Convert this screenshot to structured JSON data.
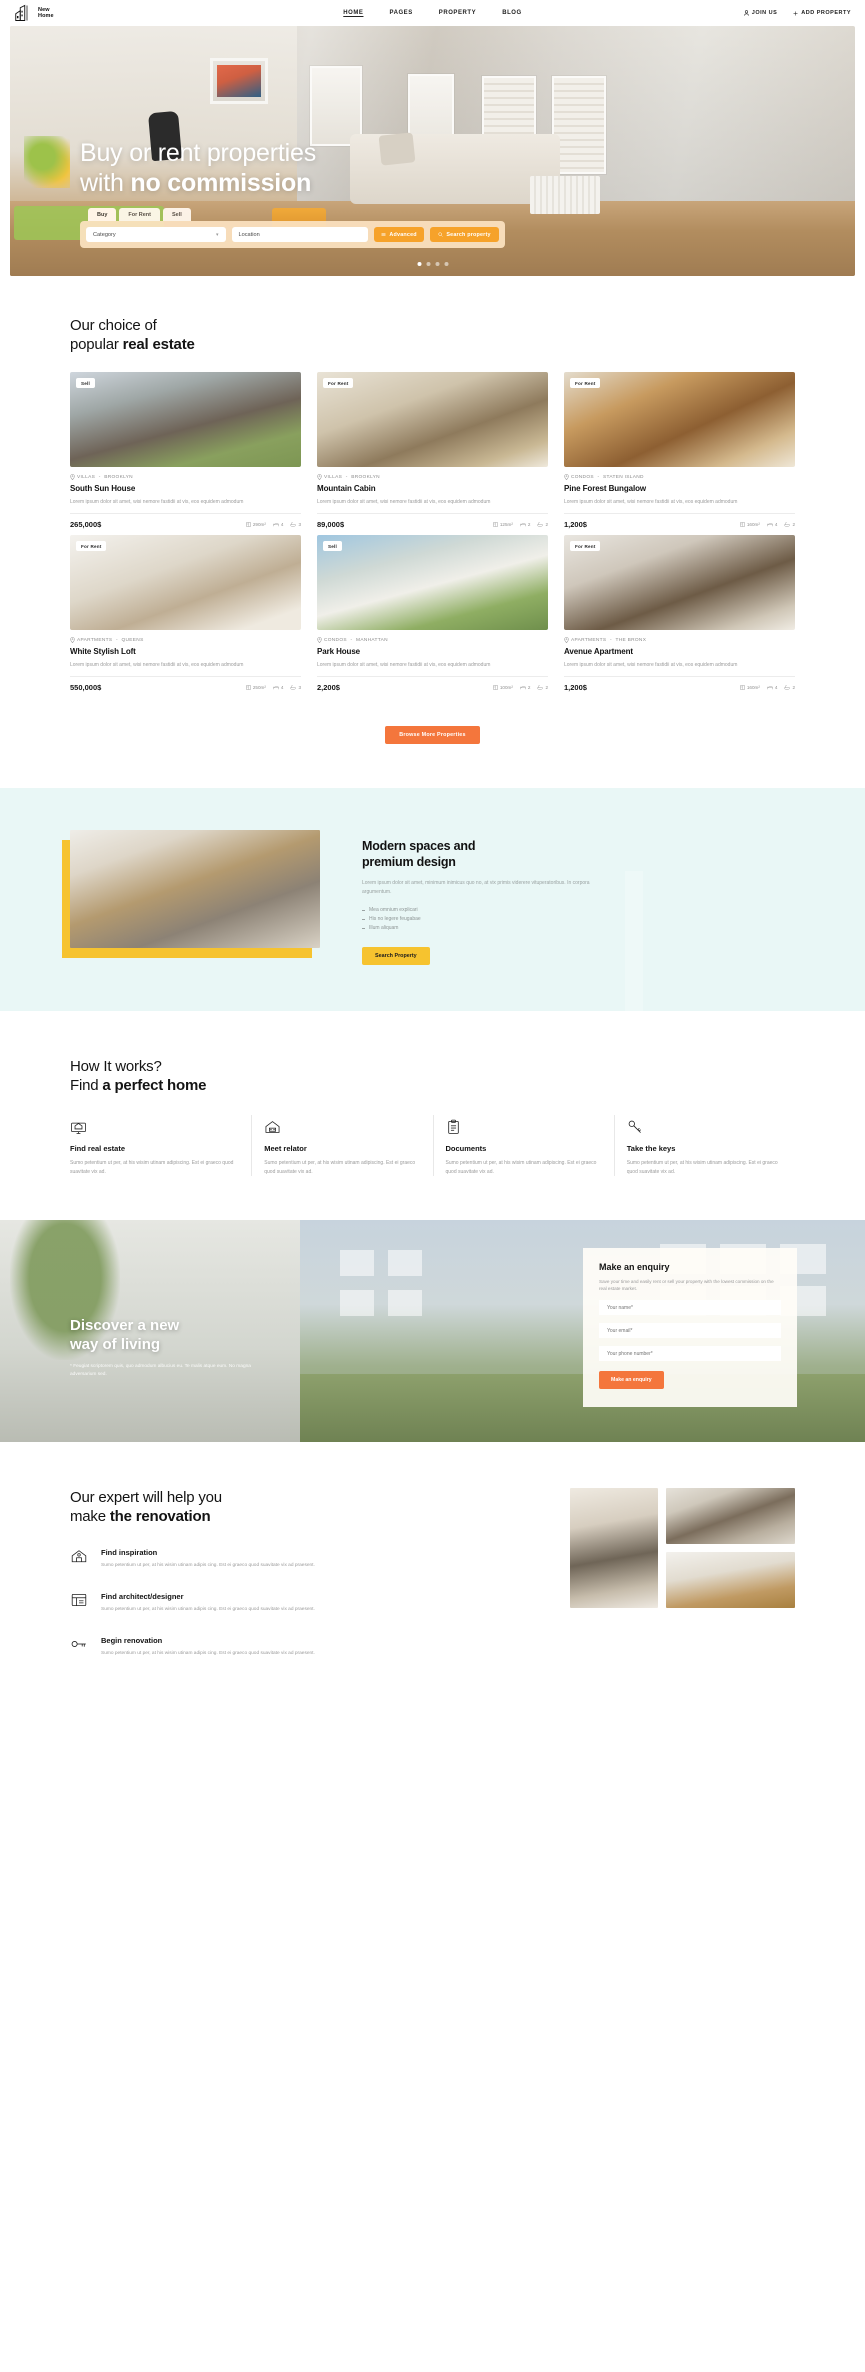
{
  "header": {
    "brand": {
      "line1": "New",
      "line2": "Home",
      "icon": "building-logo-icon"
    },
    "nav": [
      {
        "label": "HOME",
        "active": true
      },
      {
        "label": "PAGES",
        "active": false
      },
      {
        "label": "PROPERTY",
        "active": false
      },
      {
        "label": "BLOG",
        "active": false
      }
    ],
    "actions": [
      {
        "label": "JOIN US",
        "icon": "user-icon"
      },
      {
        "label": "ADD PROPERTY",
        "icon": "plus-icon"
      }
    ]
  },
  "hero": {
    "title_line1": "Buy or rent properties",
    "title_line2_thin": "with ",
    "title_line2_bold": "no commission",
    "tabs": [
      {
        "label": "Buy",
        "active": true
      },
      {
        "label": "For Rent",
        "active": false
      },
      {
        "label": "Sell",
        "active": false
      }
    ],
    "category_placeholder": "Category",
    "location_placeholder": "Location",
    "advanced_label": "Advanced",
    "search_label": "Search property",
    "slide_count": 4,
    "active_slide": 1
  },
  "properties": {
    "title_thin": "Our choice of",
    "title_bold_prefix": "popular ",
    "title_bold": "real estate",
    "browse_label": "Browse More Properties",
    "items": [
      {
        "badge": "Sell",
        "category": "VILLAS",
        "location": "Brooklyn",
        "title": "South Sun House",
        "desc": "Lorem ipsum dolor sit amet, wisi nemore fastidii at vis, eos equidem admodum",
        "price": "265,000$",
        "area": "290m²",
        "beds": "4",
        "baths": "3",
        "photo": "p-villa"
      },
      {
        "badge": "For Rent",
        "category": "VILLAS",
        "location": "Brooklyn",
        "title": "Mountain Cabin",
        "desc": "Lorem ipsum dolor sit amet, wisi nemore fastidii at vis, eos equidem admodum",
        "price": "89,000$",
        "area": "125m²",
        "beds": "2",
        "baths": "2",
        "photo": "p-kitchen"
      },
      {
        "badge": "For Rent",
        "category": "CONDOS",
        "location": "Staten Island",
        "title": "Pine Forest Bungalow",
        "desc": "Lorem ipsum dolor sit amet, wisi nemore fastidii at vis, eos equidem admodum",
        "price": "1,200$",
        "area": "160m²",
        "beds": "4",
        "baths": "2",
        "photo": "p-loft"
      },
      {
        "badge": "For Rent",
        "category": "APARTMENTS",
        "location": "Queens",
        "title": "White Stylish Loft",
        "desc": "Lorem ipsum dolor sit amet, wisi nemore fastidii at vis, eos equidem admodum",
        "price": "550,000$",
        "area": "250m²",
        "beds": "4",
        "baths": "3",
        "photo": "p-white"
      },
      {
        "badge": "Sell",
        "category": "CONDOS",
        "location": "Manhattan",
        "title": "Park House",
        "desc": "Lorem ipsum dolor sit amet, wisi nemore fastidii at vis, eos equidem admodum",
        "price": "2,200$",
        "area": "100m²",
        "beds": "2",
        "baths": "2",
        "photo": "p-park"
      },
      {
        "badge": "For Rent",
        "category": "APARTMENTS",
        "location": "The Bronx",
        "title": "Avenue Apartment",
        "desc": "Lorem ipsum dolor sit amet, wisi nemore fastidii at vis, eos equidem admodum",
        "price": "1,200$",
        "area": "160m²",
        "beds": "4",
        "baths": "2",
        "photo": "p-avenue"
      }
    ]
  },
  "modern": {
    "title_line1": "Modern spaces and",
    "title_line2": "premium design",
    "desc": "Lorem ipsum dolor sit amet, minimum inimicus quo no, at vix primis viderere vituperatoribus. In corpora argumentum.",
    "bullets": [
      "Mea omnium explicari",
      "His no legere feugabae",
      "Illum aliquam"
    ],
    "cta_label": "Search Property"
  },
  "howit": {
    "title_thin": "How It works?",
    "title_bold_prefix": "Find ",
    "title_bold": "a perfect home",
    "steps": [
      {
        "icon": "find-real-estate-icon",
        "title": "Find real estate",
        "desc": "Sumo petentium ut per, at his wisim utinam adipiscing. Est ei graeco quod suavitate vix ad."
      },
      {
        "icon": "meet-relator-icon",
        "title": "Meet relator",
        "desc": "Sumo petentium ut per, at his wisim utinam adipiscing. Est ei graeco quod suavitate vix ad."
      },
      {
        "icon": "documents-icon",
        "title": "Documents",
        "desc": "Sumo petentium ut per, at his wisim utinam adipiscing. Est ei graeco quod suavitate vix ad."
      },
      {
        "icon": "take-the-keys-icon",
        "title": "Take the keys",
        "desc": "Sumo petentium ut per, at his wisim utinam adipiscing. Est ei graeco quod suavitate vix ad."
      }
    ]
  },
  "discover": {
    "title_line1": "Discover a new",
    "title_line2": "way of living",
    "subtitle": "* Feugiat scriptorem quis, quo admodum albucius eu. Te malis atque eum. No magna adversarium sed.",
    "enquiry": {
      "title": "Make an enquiry",
      "subtitle": "Save your time and easily rent or sell your property with the lowest commission on the real estate market.",
      "fields": [
        {
          "placeholder": "Your name*",
          "value": ""
        },
        {
          "placeholder": "Your email*",
          "value": ""
        },
        {
          "placeholder": "Your phone number*",
          "value": ""
        }
      ],
      "submit_label": "Make an enquiry"
    }
  },
  "expert": {
    "title_thin": "Our expert will help you",
    "title_bold_prefix": "make ",
    "title_bold": "the renovation",
    "items": [
      {
        "icon": "inspiration-icon",
        "title": "Find inspiration",
        "desc": "Sumo petentium ut per, at his wisim utinam adipis cing. Est ei graeco quod suavitate vix ad praesent."
      },
      {
        "icon": "architect-icon",
        "title": "Find architect/designer",
        "desc": "Sumo petentium ut per, at his wisim utinam adipis cing. Est ei graeco quod suavitate vix ad praesent."
      },
      {
        "icon": "renovation-key-icon",
        "title": "Begin renovation",
        "desc": "Sumo petentium ut per, at his wisim utinam adipis cing. Est ei graeco quod suavitate vix ad praesent."
      }
    ]
  },
  "colors": {
    "accent_orange": "#f4763c",
    "accent_yellow": "#f6c32f",
    "hero_button": "#f6a22a",
    "band_mint": "#e9f7f6",
    "text_dark": "#131313",
    "text_muted": "#9c9c9c"
  }
}
